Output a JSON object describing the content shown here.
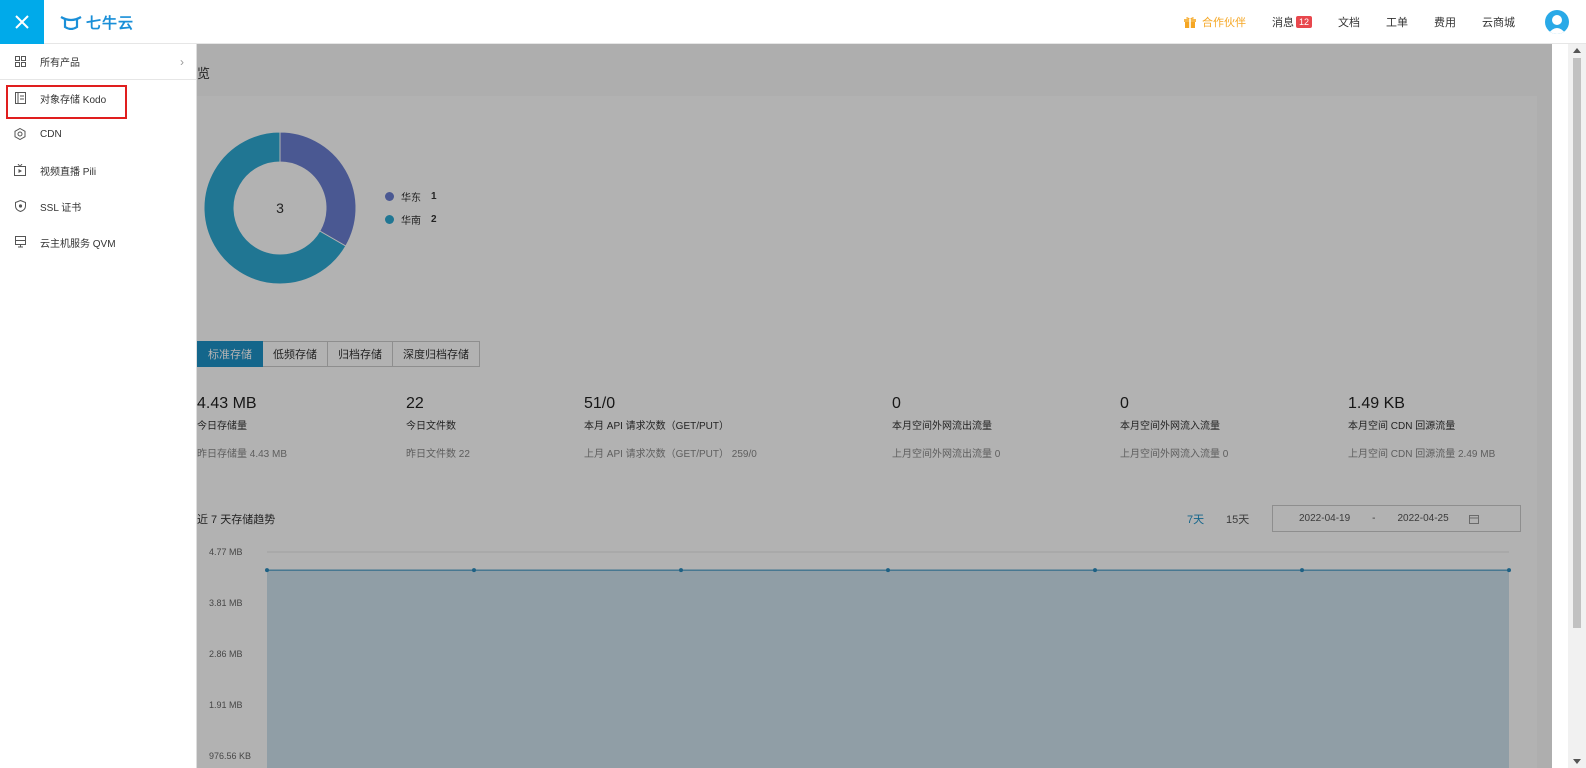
{
  "topbar": {
    "logo_text": "七牛云",
    "items": [
      {
        "label": "合作伙伴",
        "icon": "gift-icon"
      },
      {
        "label": "消息",
        "badge": "12"
      },
      {
        "label": "文档"
      },
      {
        "label": "工单"
      },
      {
        "label": "费用"
      },
      {
        "label": "云商城"
      }
    ]
  },
  "sidebar": {
    "all_products": "所有产品",
    "items": [
      {
        "label": "对象存储 Kodo",
        "icon": "storage-icon"
      },
      {
        "label": "CDN",
        "icon": "cdn-icon"
      },
      {
        "label": "视频直播 Pili",
        "icon": "live-video-icon"
      },
      {
        "label": "SSL 证书",
        "icon": "ssl-shield-icon"
      },
      {
        "label": "云主机服务 QVM",
        "icon": "server-icon"
      }
    ]
  },
  "main": {
    "page_title": "览",
    "donut": {
      "center": "3",
      "segments": [
        {
          "label": "华东",
          "value": 1,
          "color": "#6a7fd2"
        },
        {
          "label": "华南",
          "value": 2,
          "color": "#2ea9d3"
        }
      ]
    },
    "tabs": [
      "标准存储",
      "低频存储",
      "归档存储",
      "深度归档存储"
    ],
    "stats": [
      {
        "value": "4.43 MB",
        "label": "今日存储量",
        "sub": "昨日存储量 4.43 MB"
      },
      {
        "value": "22",
        "label": "今日文件数",
        "sub": "昨日文件数 22"
      },
      {
        "value": "51/0",
        "label": "本月 API 请求次数（GET/PUT）",
        "sub": "上月 API 请求次数（GET/PUT） 259/0"
      },
      {
        "value": "0",
        "label": "本月空间外网流出流量",
        "sub": "上月空间外网流出流量 0"
      },
      {
        "value": "0",
        "label": "本月空间外网流入流量",
        "sub": "上月空间外网流入流量 0"
      },
      {
        "value": "1.49 KB",
        "label": "本月空间 CDN 回源流量",
        "sub": "上月空间 CDN 回源流量 2.49 MB"
      }
    ],
    "trend": {
      "title": "近 7 天存储趋势",
      "range_7": "7天",
      "range_15": "15天",
      "date_start": "2022-04-19",
      "date_sep": "-",
      "date_end": "2022-04-25"
    }
  },
  "chart_data": {
    "type": "area",
    "y_tick_labels": [
      "4.77 MB",
      "3.81 MB",
      "2.86 MB",
      "1.91 MB",
      "976.56 KB"
    ],
    "series": [
      {
        "values": [
          4.43,
          4.43,
          4.43,
          4.43,
          4.43,
          4.43,
          4.43
        ]
      }
    ],
    "y_unit": "MB",
    "ylim": [
      0,
      4.77
    ],
    "color": "#2b8cbe"
  }
}
